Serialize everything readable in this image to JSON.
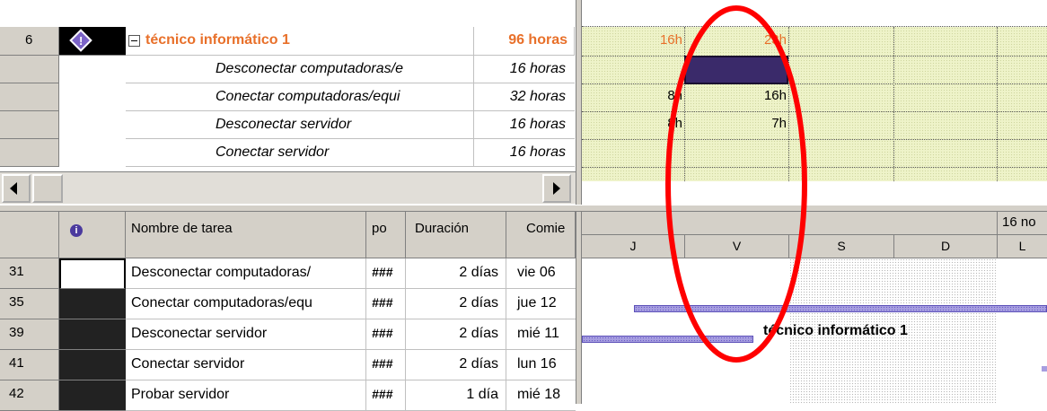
{
  "usage_table": {
    "group_row": {
      "id": "6",
      "name": "técnico informático 1",
      "work": "96 horas",
      "day1": "16h",
      "day2": "23h"
    },
    "task_rows": [
      {
        "name": "Desconectar computadoras/e",
        "work": "16 horas",
        "day1": "",
        "day2": ""
      },
      {
        "name": "Conectar computadoras/equi",
        "work": "32 horas",
        "day1": "8h",
        "day2": "16h"
      },
      {
        "name": "Desconectar servidor",
        "work": "16 horas",
        "day1": "8h",
        "day2": "7h"
      },
      {
        "name": "Conectar servidor",
        "work": "16 horas",
        "day1": "",
        "day2": ""
      }
    ]
  },
  "gantt_table": {
    "headers": {
      "info": "i",
      "name": "Nombre de tarea",
      "pred": "po",
      "duration": "Duración",
      "start": "Comie"
    },
    "rows": [
      {
        "id": "31",
        "name": "Desconectar computadoras/",
        "pred": "###",
        "duration": "2 días",
        "start": "vie 06"
      },
      {
        "id": "35",
        "name": "Conectar computadoras/equ",
        "pred": "###",
        "duration": "2 días",
        "start": "jue 12"
      },
      {
        "id": "39",
        "name": "Desconectar servidor",
        "pred": "###",
        "duration": "2 días",
        "start": "mié 11"
      },
      {
        "id": "41",
        "name": "Conectar servidor",
        "pred": "###",
        "duration": "2 días",
        "start": "lun 16"
      },
      {
        "id": "42",
        "name": "Probar servidor",
        "pred": "###",
        "duration": "1 día",
        "start": "mié 18"
      }
    ]
  },
  "timescale": {
    "week_label": "16 no",
    "days": [
      "J",
      "V",
      "S",
      "D",
      "L"
    ]
  },
  "gantt_bar_label": "técnico informático 1",
  "colors": {
    "accent_orange": "#e8702a",
    "annotation_red": "#ff0000",
    "bar_purple": "#a79ee0"
  }
}
